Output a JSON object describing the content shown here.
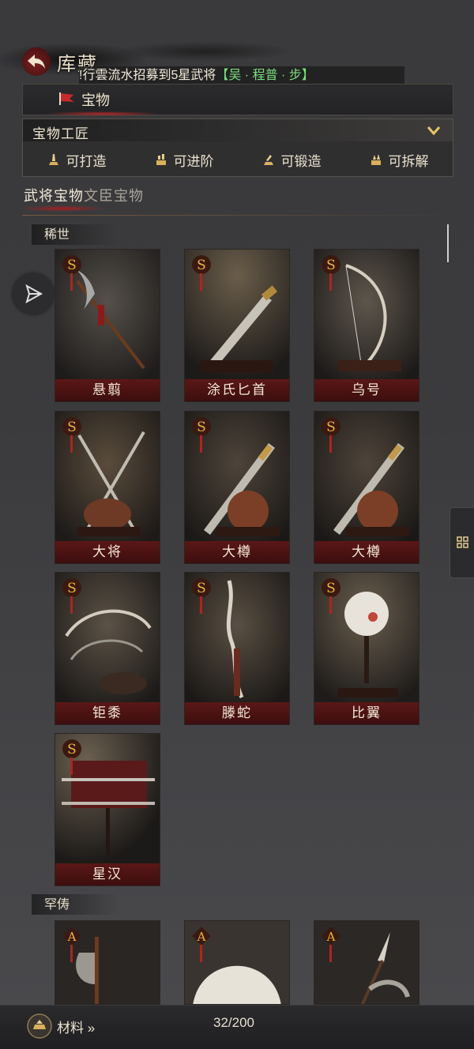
{
  "header": {
    "title": "库藏"
  },
  "marquee": {
    "prefix": "!行雲流水",
    "middle": "招募到5星武将",
    "highlight": "【吴 · 程普 · 步】"
  },
  "tabs": {
    "active": "宝物"
  },
  "craft": {
    "title": "宝物工匠",
    "items": [
      {
        "label": "可打造"
      },
      {
        "label": "可进阶"
      },
      {
        "label": "可锻造"
      },
      {
        "label": "可拆解"
      }
    ]
  },
  "categories": [
    {
      "label": "武将宝物",
      "active": true
    },
    {
      "label": "文臣宝物",
      "active": false
    }
  ],
  "sections": [
    {
      "label": "稀世",
      "cards": [
        {
          "grade": "S",
          "name": "悬翦",
          "icon": "halberd-icon"
        },
        {
          "grade": "S",
          "name": "涂氏匕首",
          "icon": "dagger-icon"
        },
        {
          "grade": "S",
          "name": "乌号",
          "icon": "bow-icon"
        },
        {
          "grade": "S",
          "name": "大将",
          "icon": "crossed-blades-icon"
        },
        {
          "grade": "S",
          "name": "大樽",
          "icon": "sword-icon"
        },
        {
          "grade": "S",
          "name": "大樽",
          "icon": "sword-icon"
        },
        {
          "grade": "S",
          "name": "钜黍",
          "icon": "bow-icon"
        },
        {
          "grade": "S",
          "name": "滕蛇",
          "icon": "spear-icon"
        },
        {
          "grade": "S",
          "name": "比翼",
          "icon": "fan-icon"
        },
        {
          "grade": "S",
          "name": "星汉",
          "icon": "sword-rack-icon"
        }
      ]
    },
    {
      "label": "罕俦",
      "cards": [
        {
          "grade": "A",
          "name": "",
          "icon": "axe-icon"
        },
        {
          "grade": "A",
          "name": "",
          "icon": "feather-fan-icon"
        },
        {
          "grade": "A",
          "name": "",
          "icon": "glaive-icon"
        }
      ]
    }
  ],
  "footer": {
    "materials_label": "材料 »",
    "count": "32/200"
  },
  "colors": {
    "accent_red": "#5b1717",
    "highlight_green": "#7be07b",
    "panel": "#2b2b2d"
  }
}
